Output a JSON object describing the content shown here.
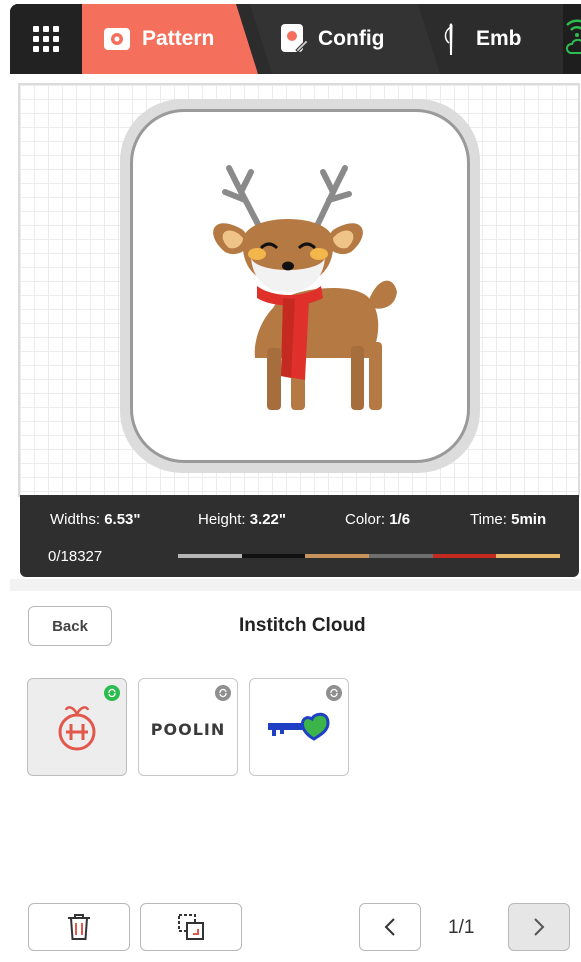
{
  "tabs": [
    {
      "label": "Pattern",
      "icon": "pattern-icon",
      "active": true
    },
    {
      "label": "Config",
      "icon": "config-icon",
      "active": false
    },
    {
      "label": "Emb",
      "icon": "needle-icon",
      "active": false
    }
  ],
  "status": {
    "icon": "wifi-cloud-icon",
    "color": "#2dbd4e"
  },
  "design": {
    "name": "reindeer-embroidery-design"
  },
  "info": {
    "width_label": "Widths:",
    "width_value": "6.53\"",
    "height_label": "Height:",
    "height_value": "3.22\"",
    "color_label": "Color:",
    "color_value": "1/6",
    "time_label": "Time:",
    "time_value": "5min",
    "stitches": "0/18327",
    "thread_colors": [
      "#b5b5b5",
      "#111111",
      "#c8935a",
      "#6e6e6e",
      "#c42a20",
      "#e8b86a"
    ]
  },
  "cloud": {
    "back_label": "Back",
    "title": "Institch Cloud",
    "items": [
      {
        "name": "tomato-logo",
        "selected": true,
        "synced": true
      },
      {
        "name": "poolin-logo",
        "text": "POOLIN",
        "selected": false,
        "synced": false
      },
      {
        "name": "key-heart",
        "selected": false,
        "synced": false
      }
    ]
  },
  "pagination": {
    "label": "1/1"
  },
  "colors": {
    "accent": "#f5705c",
    "topbar": "#2c2c2c",
    "synced": "#2dbd4e"
  }
}
